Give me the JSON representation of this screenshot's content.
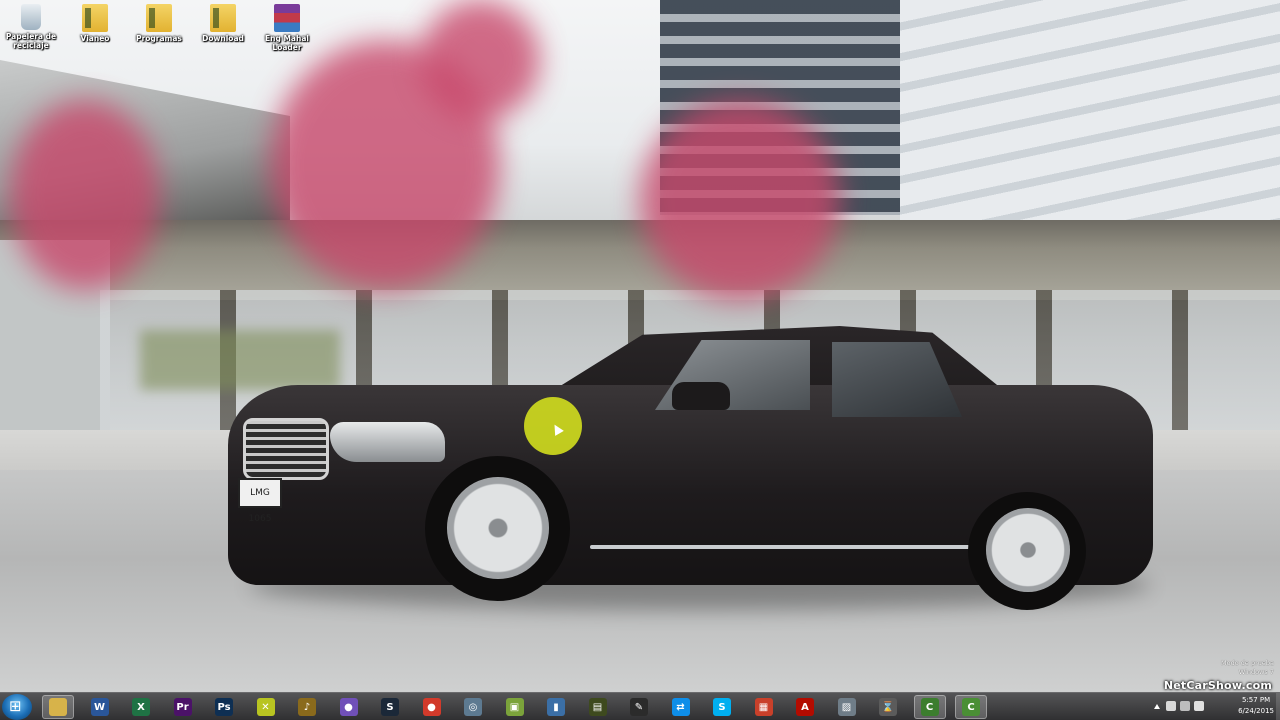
{
  "desktop": {
    "icons": [
      {
        "label": "Papelera de reciclaje",
        "icon": "recycle-bin-icon"
      },
      {
        "label": "Vianeo",
        "icon": "folder-icon"
      },
      {
        "label": "Programas",
        "icon": "folder-icon"
      },
      {
        "label": "Download",
        "icon": "folder-icon"
      },
      {
        "label": "Eng Mahal Loader",
        "icon": "winrar-archive-icon"
      }
    ],
    "wallpaper": {
      "subject": "black luxury sedan",
      "plate": "LMG 1065"
    }
  },
  "watermark": {
    "activation_line1": "Modo de prueba",
    "activation_line2": "Windows 7",
    "brand": "NetCarShow.com"
  },
  "taskbar": {
    "apps": [
      {
        "name": "file-explorer",
        "letter": "",
        "color": "#d7b34a",
        "active": true
      },
      {
        "name": "word",
        "letter": "W",
        "color": "#2a5699"
      },
      {
        "name": "excel",
        "letter": "X",
        "color": "#1f7244"
      },
      {
        "name": "premiere",
        "letter": "Pr",
        "color": "#4b1268"
      },
      {
        "name": "photoshop",
        "letter": "Ps",
        "color": "#0e2f53"
      },
      {
        "name": "tool-yellow-cross",
        "letter": "✕",
        "color": "#b8c421"
      },
      {
        "name": "winamp",
        "letter": "♪",
        "color": "#8a6a1c"
      },
      {
        "name": "purple-app",
        "letter": "●",
        "color": "#7050b8"
      },
      {
        "name": "steam",
        "letter": "S",
        "color": "#1b2838"
      },
      {
        "name": "chrome",
        "letter": "●",
        "color": "#d23a2b"
      },
      {
        "name": "disc-app",
        "letter": "◎",
        "color": "#5d7a91"
      },
      {
        "name": "folder-green",
        "letter": "▣",
        "color": "#7ba33b"
      },
      {
        "name": "usb-app",
        "letter": "▮",
        "color": "#3b6fa6"
      },
      {
        "name": "media-app",
        "letter": "▤",
        "color": "#3e4a1e"
      },
      {
        "name": "pen-tool",
        "letter": "✎",
        "color": "#2b2b2b"
      },
      {
        "name": "teamviewer",
        "letter": "⇄",
        "color": "#0e8ee9"
      },
      {
        "name": "skype",
        "letter": "S",
        "color": "#00aff0"
      },
      {
        "name": "grid-app",
        "letter": "▦",
        "color": "#c9402a"
      },
      {
        "name": "acrobat",
        "letter": "A",
        "color": "#b30b00"
      },
      {
        "name": "image-app",
        "letter": "▨",
        "color": "#6f7d88"
      },
      {
        "name": "hourglass-app",
        "letter": "⌛",
        "color": "#5b5b5b"
      },
      {
        "name": "camtasia-1",
        "letter": "C",
        "color": "#3c7d2e",
        "active": true
      },
      {
        "name": "camtasia-2",
        "letter": "C",
        "color": "#4a8f35",
        "active": true
      }
    ],
    "tray": {
      "time": "5:57 PM",
      "date": "6/24/2015"
    }
  }
}
